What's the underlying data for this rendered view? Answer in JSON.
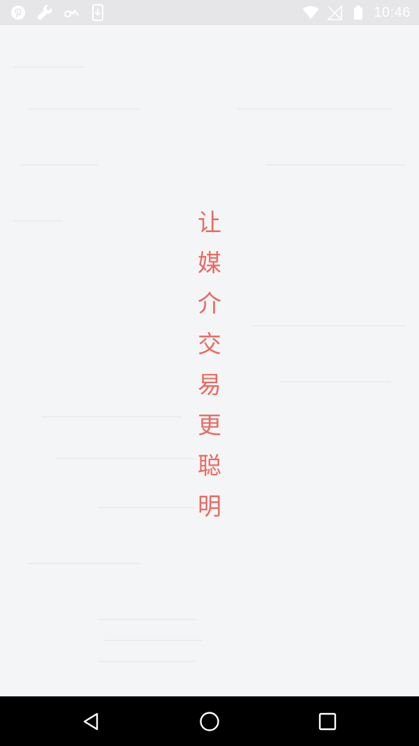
{
  "status_bar": {
    "time": "10:46",
    "left_icons": [
      "pinterest-icon",
      "wrench-icon",
      "glasses-icon",
      "download-icon"
    ],
    "right_icons": [
      "wifi-icon",
      "no-signal-icon",
      "battery-icon"
    ]
  },
  "splash": {
    "slogan_chars": [
      "让",
      "媒",
      "介",
      "交",
      "易",
      "更",
      "聪",
      "明"
    ],
    "text_color": "#ea6b62",
    "background_color": "#f4f5f7"
  },
  "nav_bar": {
    "buttons": [
      "back-icon",
      "home-icon",
      "recents-icon"
    ]
  }
}
